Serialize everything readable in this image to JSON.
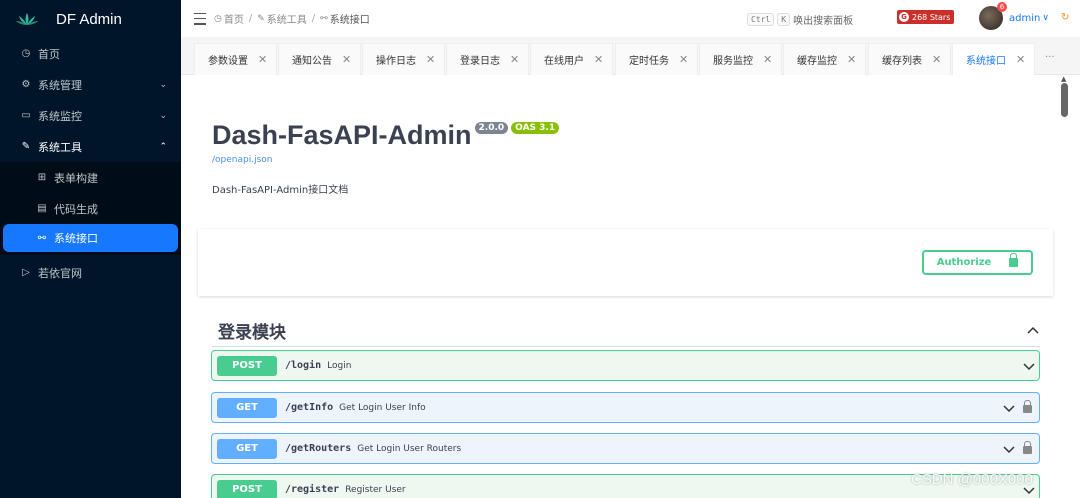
{
  "sidebar": {
    "brand": "DF Admin",
    "items": [
      {
        "label": "首页",
        "icon": "dashboard-icon"
      },
      {
        "label": "系统管理",
        "icon": "gear-icon",
        "arrow": "chevron-down"
      },
      {
        "label": "系统监控",
        "icon": "monitor-icon",
        "arrow": "chevron-down"
      },
      {
        "label": "系统工具",
        "icon": "tool-icon",
        "arrow": "chevron-up"
      },
      {
        "label": "若依官网",
        "icon": "send-icon"
      }
    ],
    "submenu": [
      {
        "label": "表单构建",
        "icon": "form-icon"
      },
      {
        "label": "代码生成",
        "icon": "code-icon"
      },
      {
        "label": "系统接口",
        "icon": "link-icon",
        "active": true
      }
    ]
  },
  "header": {
    "breadcrumb": [
      "首页",
      "系统工具",
      "系统接口"
    ],
    "search_keys": [
      "Ctrl",
      "K"
    ],
    "search_label": "唤出搜索面板",
    "stars": "268 Stars",
    "user": "admin",
    "notify_count": "6"
  },
  "tabs": [
    "参数设置",
    "通知公告",
    "操作日志",
    "登录日志",
    "在线用户",
    "定时任务",
    "服务监控",
    "缓存监控",
    "缓存列表",
    "系统接口"
  ],
  "tabs_more": "···",
  "swagger": {
    "title": "Dash-FasAPI-Admin",
    "version": "2.0.0",
    "oas": "OAS 3.1",
    "spec_link": "/openapi.json",
    "description": "Dash-FasAPI-Admin接口文档",
    "authorize": "Authorize",
    "section": "登录模块",
    "operations": [
      {
        "method": "POST",
        "path": "/login",
        "summary": "Login",
        "locked": false
      },
      {
        "method": "GET",
        "path": "/getInfo",
        "summary": "Get Login User Info",
        "locked": true
      },
      {
        "method": "GET",
        "path": "/getRouters",
        "summary": "Get Login User Routers",
        "locked": true
      },
      {
        "method": "POST",
        "path": "/register",
        "summary": "Register User",
        "locked": false
      }
    ]
  },
  "watermark": "CSDN @000X000",
  "colors": {
    "sidebar": "#001529",
    "active": "#1677ff",
    "post": "#49cc90",
    "get": "#61affe"
  }
}
